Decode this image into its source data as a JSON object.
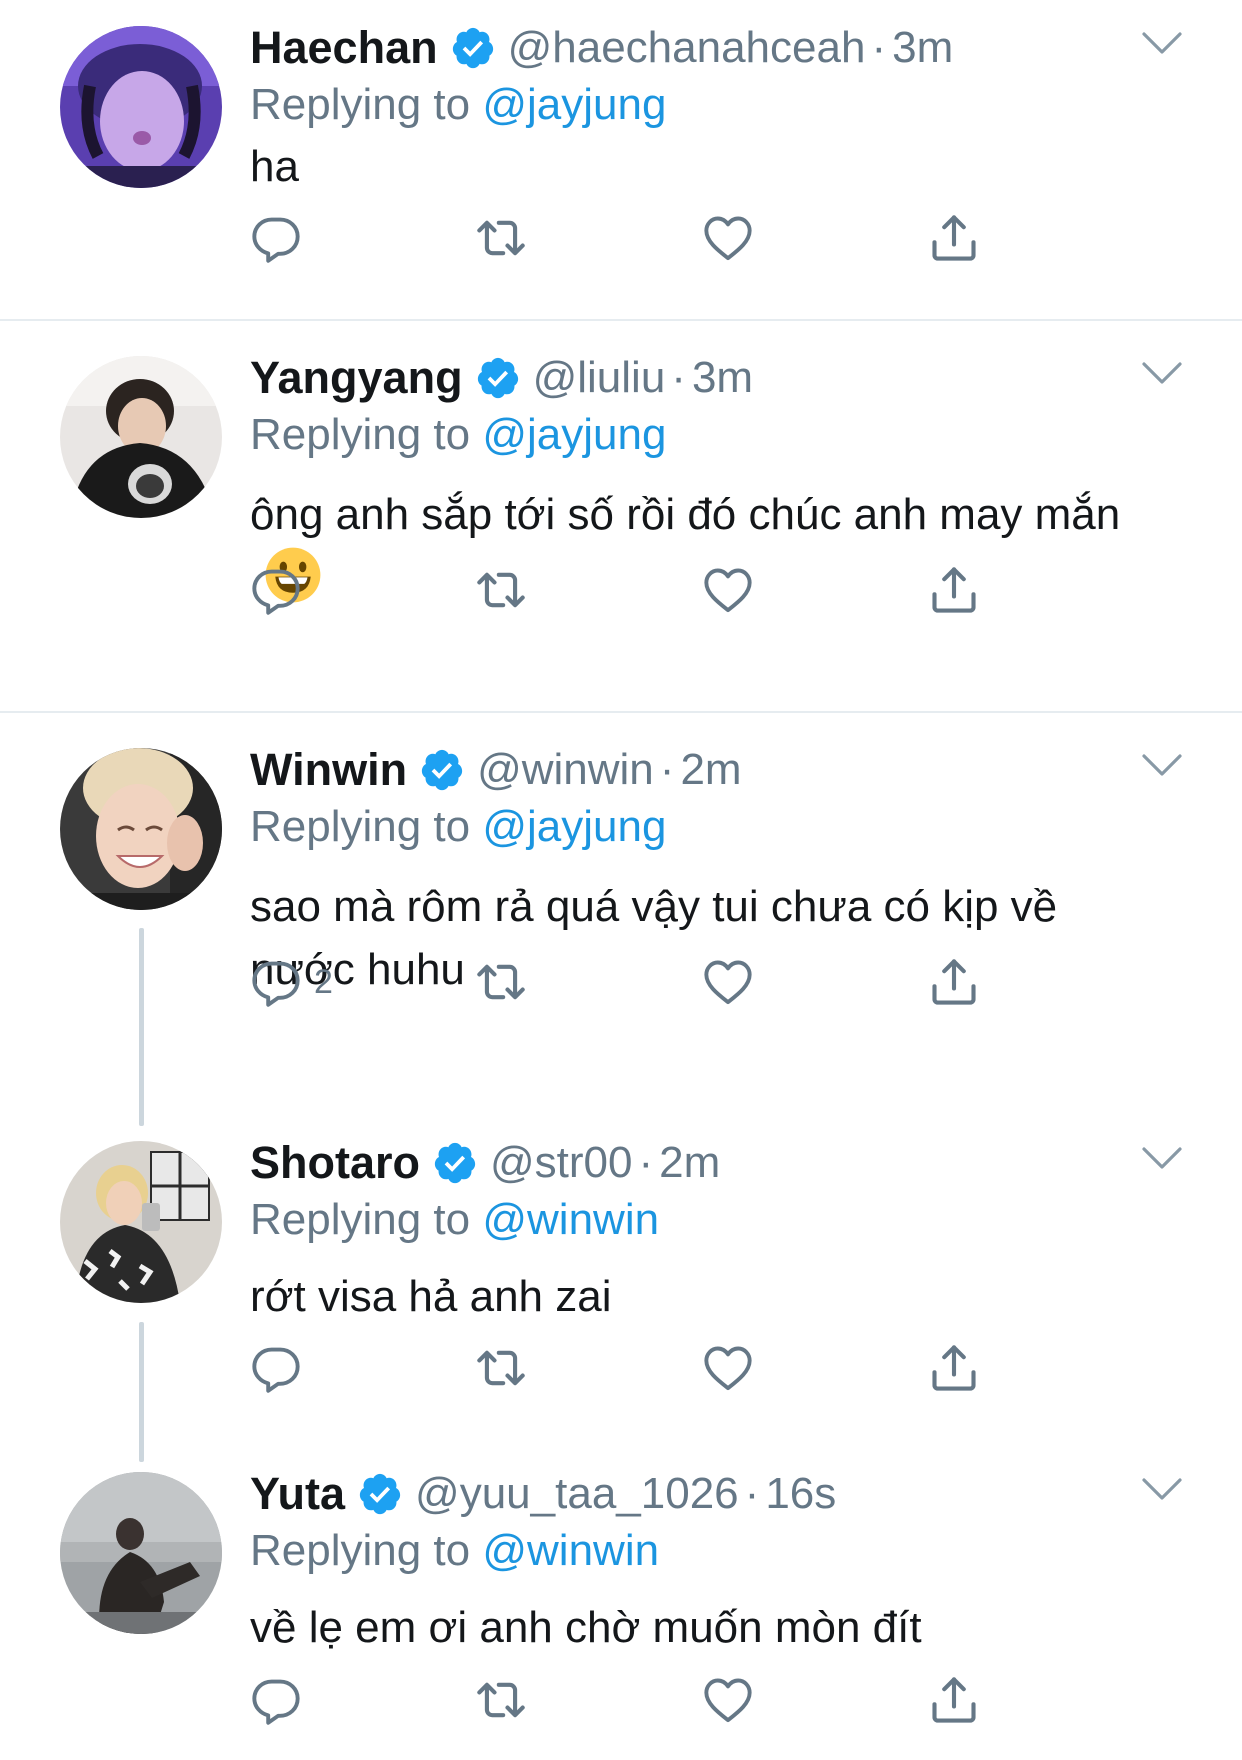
{
  "tweets": [
    {
      "name": "Haechan",
      "handle": "@haechanahceah",
      "time": "3m",
      "reply_prefix": "Replying to ",
      "reply_to": "@jayjung",
      "text": "ha",
      "reply_count": ""
    },
    {
      "name": "Yangyang",
      "handle": "@liuliu",
      "time": "3m",
      "reply_prefix": "Replying to ",
      "reply_to": "@jayjung",
      "text": "ông anh sắp tới số rồi đó chúc anh may mắn",
      "emoji": "grinning-face-emoji",
      "reply_count": ""
    },
    {
      "name": "Winwin",
      "handle": "@winwin",
      "time": "2m",
      "reply_prefix": "Replying to ",
      "reply_to": "@jayjung",
      "text": "sao mà rôm rả quá vậy tui chưa có kịp về nước huhu",
      "reply_count": "2"
    },
    {
      "name": "Shotaro",
      "handle": "@str00",
      "time": "2m",
      "reply_prefix": "Replying to ",
      "reply_to": "@winwin",
      "text": "rớt visa hả anh zai",
      "reply_count": ""
    },
    {
      "name": "Yuta",
      "handle": "@yuu_taa_1026",
      "time": "16s",
      "reply_prefix": "Replying to ",
      "reply_to": "@winwin",
      "text": "về lẹ em ơi anh chờ muốn mòn đít",
      "reply_count": ""
    }
  ],
  "separator": "·",
  "icons": {
    "verified": "verified-badge-icon",
    "chevron": "chevron-down-icon",
    "reply": "reply-icon",
    "retweet": "retweet-icon",
    "like": "heart-icon",
    "share": "share-icon"
  },
  "colors": {
    "link": "#1b95e0",
    "verified": "#1da1f2",
    "muted": "#657786",
    "text": "#14171a",
    "divider": "#e6ecf0",
    "thread_line": "#ccd6dd"
  }
}
